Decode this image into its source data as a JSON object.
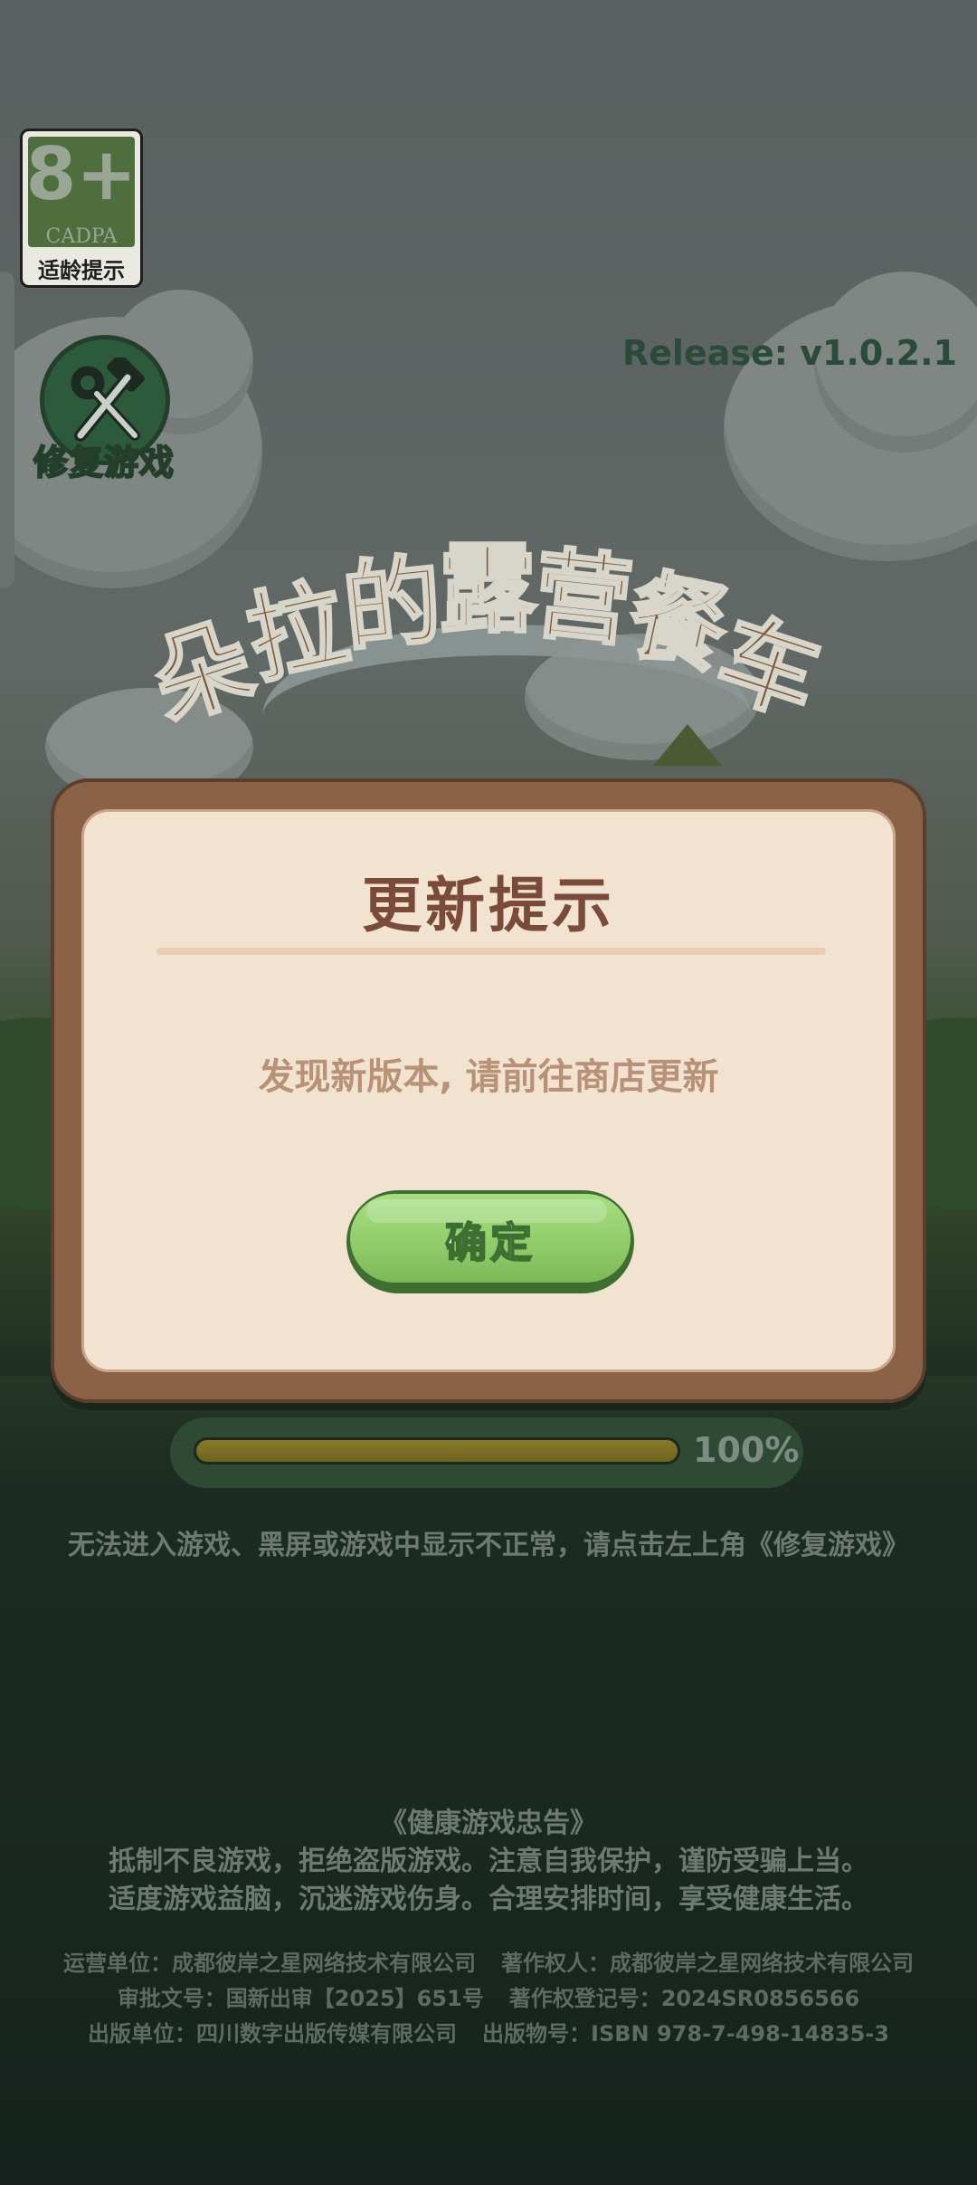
{
  "age_rating": {
    "age": "8+",
    "org": "CADPA",
    "hint": "适龄提示"
  },
  "repair": {
    "label": "修复游戏",
    "icon": "wrench-hammer-icon"
  },
  "release": "Release: v1.0.2.1",
  "game_title": "朵拉的露营餐车",
  "dialog": {
    "title": "更新提示",
    "message": "发现新版本, 请前往商店更新",
    "confirm_label": "确定"
  },
  "progress": {
    "value": 1.0,
    "percent_label": "100%"
  },
  "repair_notice": "无法进入游戏、黑屏或游戏中显示不正常，请点击左上角《修复游戏》",
  "advisory": {
    "title": "《健康游戏忠告》",
    "line1": "抵制不良游戏，拒绝盗版游戏。注意自我保护，谨防受骗上当。",
    "line2": "适度游戏益脑，沉迷游戏伤身。合理安排时间，享受健康生活。"
  },
  "footer": {
    "operator": "运营单位：成都彼岸之星网络技术有限公司",
    "copyright_owner": "著作权人：成都彼岸之星网络技术有限公司",
    "approval_no": "审批文号：国新出审【2025】651号",
    "copyright_reg": "著作权登记号：2024SR0856566",
    "publisher": "出版单位：四川数字出版传媒有限公司",
    "publication_no": "出版物号：ISBN 978-7-498-14835-3"
  },
  "colors": {
    "dialog_frame": "#8a6248",
    "dialog_panel": "#f2e2d0",
    "title_brown": "#7a4b3a",
    "button_green": "#8fcb68"
  }
}
